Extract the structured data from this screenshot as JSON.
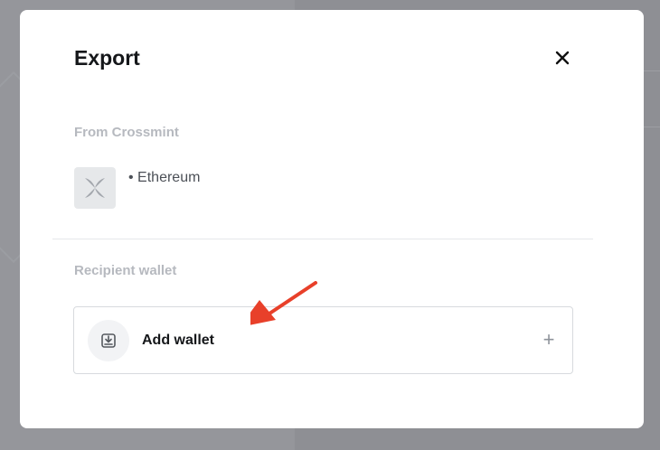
{
  "modal": {
    "title": "Export",
    "from_label": "From Crossmint",
    "item": {
      "chain_text": "• Ethereum",
      "thumbnail_icon": "crossmint-logo-icon"
    },
    "recipient_label": "Recipient wallet",
    "add_wallet": {
      "label": "Add wallet",
      "icon": "wallet-download-icon",
      "plus_glyph": "+"
    },
    "close_icon": "close-icon"
  },
  "annotation": {
    "arrow_color": "#e8402a"
  }
}
